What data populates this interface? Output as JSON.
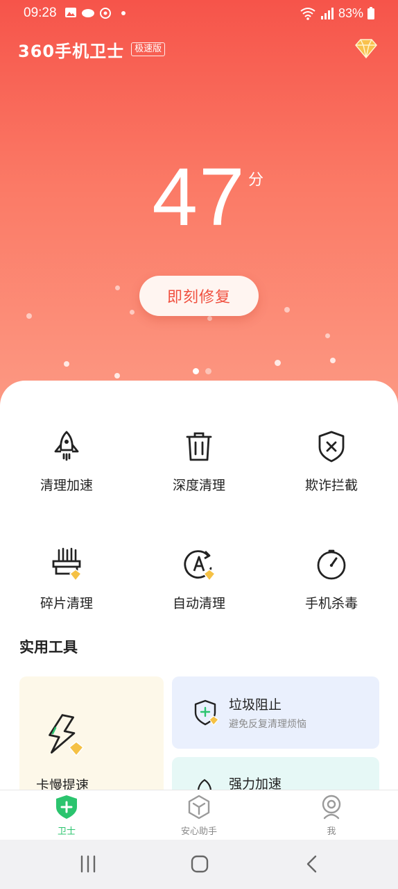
{
  "status_bar": {
    "time": "09:28",
    "battery": "83%"
  },
  "header": {
    "logo": "360手机卫士",
    "badge": "极速版",
    "vip_icon": "diamond-icon"
  },
  "score": {
    "value": "47",
    "unit": "分"
  },
  "fix_button": "即刻修复",
  "pager": {
    "count": 2,
    "active": 0
  },
  "features": [
    {
      "label": "清理加速",
      "icon": "rocket-icon"
    },
    {
      "label": "深度清理",
      "icon": "trash-icon"
    },
    {
      "label": "欺诈拦截",
      "icon": "shield-x-icon"
    },
    {
      "label": "碎片清理",
      "icon": "shredder-icon",
      "vip": true
    },
    {
      "label": "自动清理",
      "icon": "auto-clean-icon",
      "vip": true
    },
    {
      "label": "手机杀毒",
      "icon": "antivirus-icon"
    }
  ],
  "tools_section": {
    "title": "实用工具"
  },
  "tools": {
    "big": {
      "title": "卡慢提速",
      "icon": "lightning-icon"
    },
    "junk_block": {
      "title": "垃圾阻止",
      "subtitle": "避免反复清理烦恼",
      "icon": "shield-plus-icon"
    },
    "power_boost": {
      "title": "强力加速",
      "icon": "boost-icon"
    }
  },
  "tabs": [
    {
      "label": "卫士",
      "icon": "shield-plus-icon",
      "active": true
    },
    {
      "label": "安心助手",
      "icon": "assistant-icon",
      "active": false
    },
    {
      "label": "我",
      "icon": "profile-icon",
      "active": false
    }
  ],
  "colors": {
    "accent": "#f0503f",
    "active_tab": "#2bc46e",
    "vip_gold": "#f5c144"
  }
}
